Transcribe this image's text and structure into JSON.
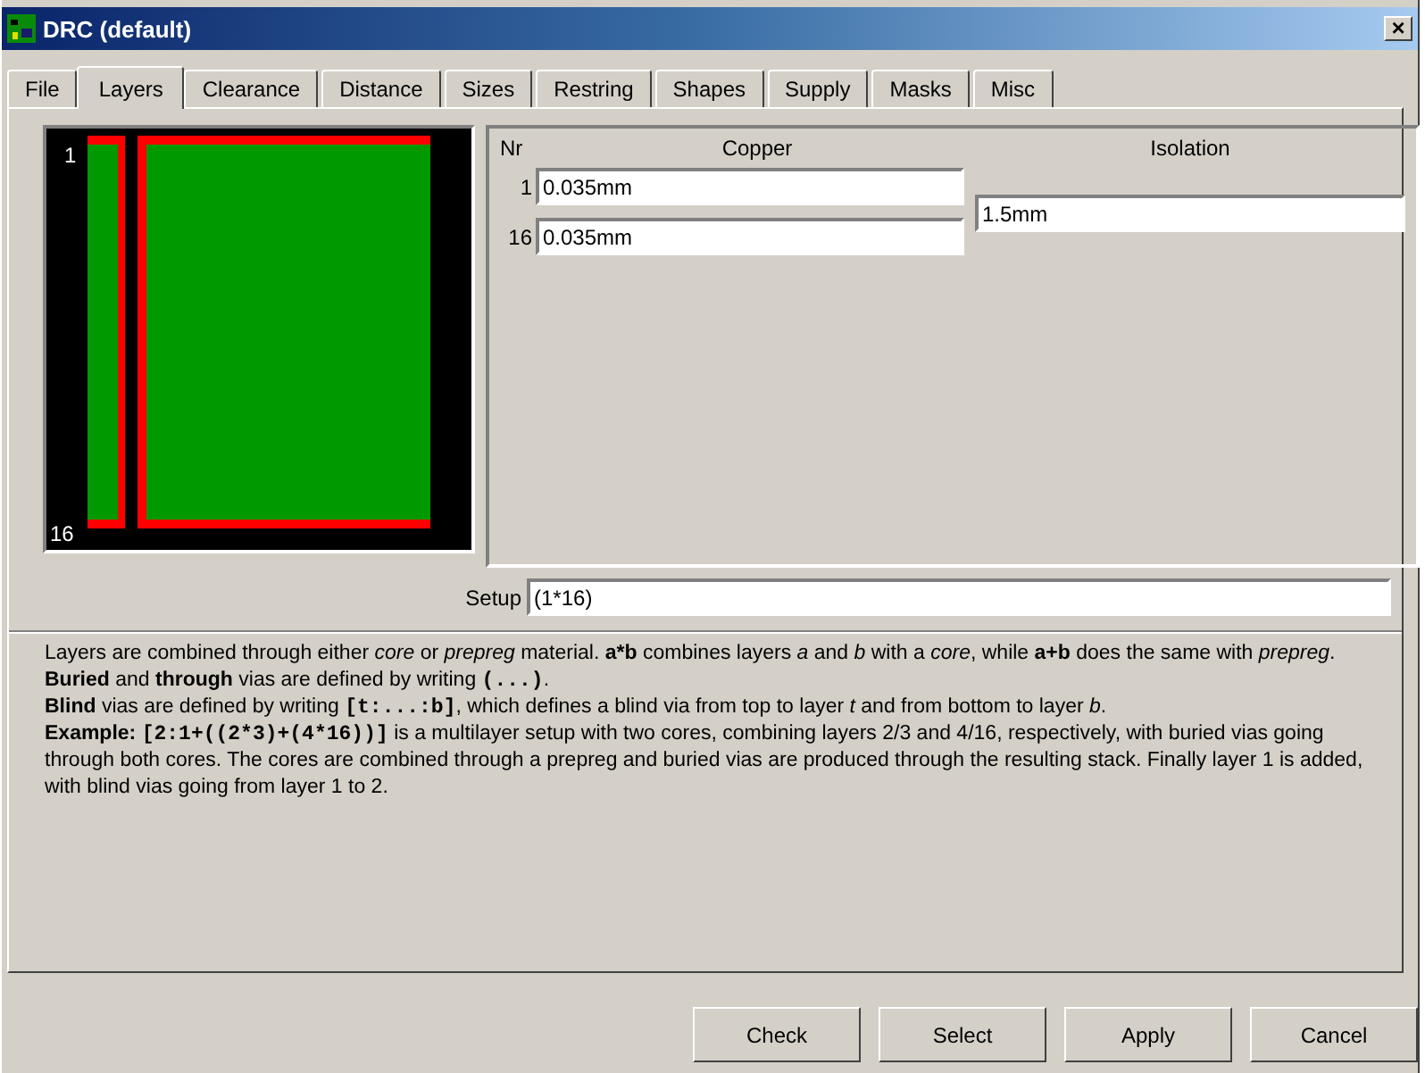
{
  "window": {
    "title": "DRC (default)",
    "close": "×"
  },
  "tabs": [
    {
      "label": "File",
      "selected": false
    },
    {
      "label": "Layers",
      "selected": true
    },
    {
      "label": "Clearance",
      "selected": false
    },
    {
      "label": "Distance",
      "selected": false
    },
    {
      "label": "Sizes",
      "selected": false
    },
    {
      "label": "Restring",
      "selected": false
    },
    {
      "label": "Shapes",
      "selected": false
    },
    {
      "label": "Supply",
      "selected": false
    },
    {
      "label": "Masks",
      "selected": false
    },
    {
      "label": "Misc",
      "selected": false
    }
  ],
  "preview": {
    "top_label": "1",
    "bottom_label": "16"
  },
  "layer_table": {
    "columns": [
      "Nr",
      "Copper",
      "Isolation"
    ],
    "rows": [
      {
        "nr": "1",
        "copper": "0.035mm"
      },
      {
        "nr": "16",
        "copper": "0.035mm"
      }
    ],
    "isolation": [
      "1.5mm"
    ]
  },
  "setup": {
    "label": "Setup",
    "value": "(1*16)"
  },
  "help": [
    [
      {
        "kind": "text",
        "text": "Layers are combined through either *core* or *prepreg* material. **a*b** combines layers *a* and *b* with a *core*, while **a+b** does the same with *prepreg*."
      }
    ],
    [
      {
        "kind": "text",
        "text": "**Buried** and **through** vias are defined by writing "
      },
      {
        "kind": "code",
        "text": "(...)"
      },
      {
        "kind": "text",
        "text": "."
      }
    ],
    [
      {
        "kind": "text",
        "text": "**Blind** vias are defined by writing "
      },
      {
        "kind": "code",
        "text": "[t:...:b]"
      },
      {
        "kind": "text",
        "text": ", which defines a blind via from top to layer *t* and from bottom to layer *b*."
      }
    ],
    [
      {
        "kind": "text",
        "text": "**Example:** "
      },
      {
        "kind": "code",
        "text": "[2:1+((2*3)+(4*16))]"
      },
      {
        "kind": "text",
        "text": " is a multilayer setup with two cores, combining layers 2/3 and 4/16, respectively, with buried vias going through both cores. The cores are combined through a prepreg and buried vias are produced through the resulting stack. Finally layer 1 is added, with blind vias going from layer 1 to 2."
      }
    ]
  ],
  "buttons": [
    "Check",
    "Select",
    "Apply",
    "Cancel"
  ]
}
